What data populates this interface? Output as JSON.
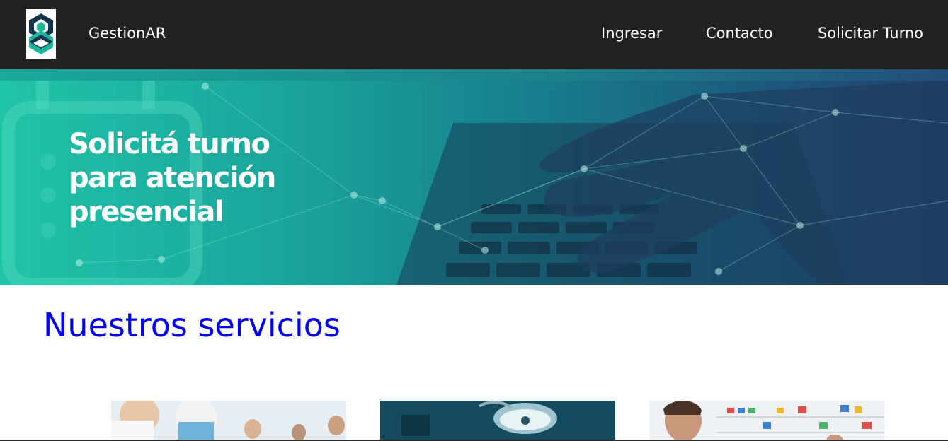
{
  "navbar": {
    "brand": "GestionAR",
    "links": [
      {
        "label": "Ingresar"
      },
      {
        "label": "Contacto"
      },
      {
        "label": "Solicitar Turno"
      }
    ]
  },
  "banner": {
    "headline_lines": [
      "Solicitá turno",
      "para atención",
      "presencial"
    ]
  },
  "services": {
    "title": "Nuestros servicios"
  },
  "colors": {
    "navbar_bg": "#222222",
    "banner_teal": "#20c4a8",
    "banner_navy": "#243f6e",
    "title_blue": "#0000ee"
  }
}
